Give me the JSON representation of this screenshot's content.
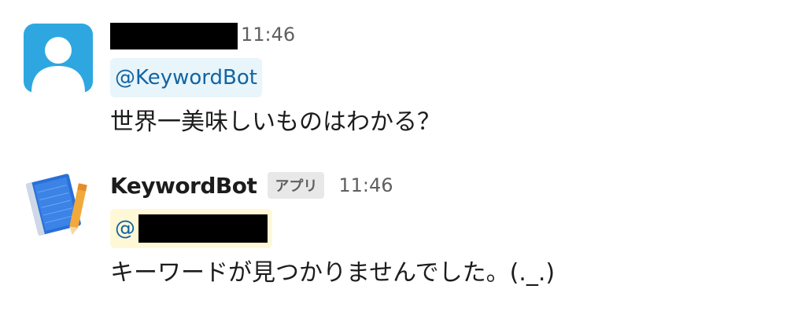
{
  "messages": [
    {
      "sender": "",
      "sender_redacted": true,
      "time": "11:46",
      "avatar": "default-user-avatar",
      "mention": "@KeywordBot",
      "text": "世界一美味しいものはわかる？"
    },
    {
      "sender": "KeywordBot",
      "badge": "アプリ",
      "time": "11:46",
      "avatar": "notebook-pencil-avatar",
      "mention": "@",
      "mention_redacted": true,
      "text": "キーワードが見つかりませんでした。(._.)"
    }
  ],
  "colors": {
    "user_avatar_bg": "#2ea7e0",
    "mention_blue": "#1264a3",
    "mention_bot_bg": "#e8f5fa",
    "mention_user_bg": "#fff8d7",
    "timestamp": "#616061",
    "badge_bg": "#e8e8e8"
  }
}
